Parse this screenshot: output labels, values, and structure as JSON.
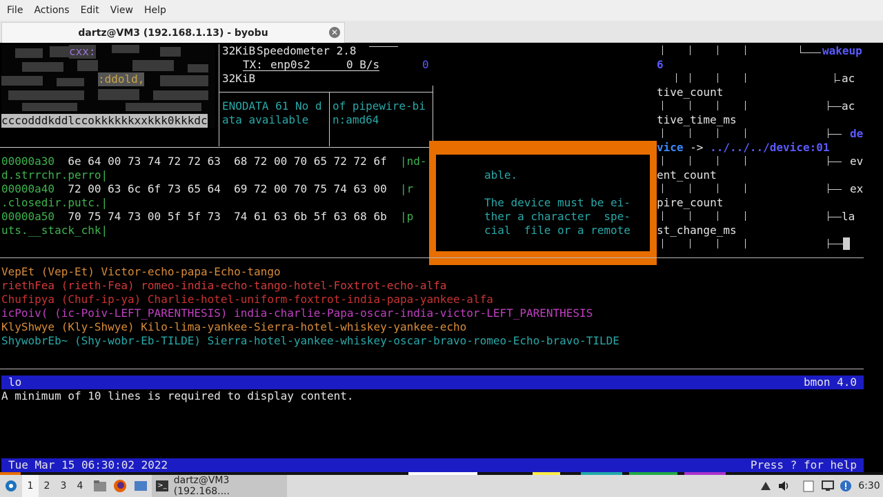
{
  "menubar": {
    "file": "File",
    "actions": "Actions",
    "edit": "Edit",
    "view": "View",
    "help": "Help"
  },
  "tab": {
    "title": "dartz@VM3 (192.168.1.13) - byobu"
  },
  "ascii_art": {
    "line1": "cxx:",
    "line2": ":ddold,",
    "line3": "cccodddkddlccokkkkkkxxkkk0kkkdc"
  },
  "speedometer": {
    "top_label": "32KiB",
    "title": "Speedometer 2.8",
    "tx_label": "TX:",
    "iface": "enp0s2",
    "rate": "0 B/s",
    "value": "0",
    "bottom_label": "32KiB"
  },
  "errno": {
    "line1": "ENODATA 61 No d",
    "line2": "ata available"
  },
  "pkg": {
    "line1": "of pipewire-bi",
    "line2": "n:amd64"
  },
  "hexdump": [
    {
      "addr": "00000a30",
      "bytes": "6e 64 00 73 74 72 72 63  68 72 00 70 65 72 72 6f",
      "ascii": "|nd-",
      "cont": "d.strrchr.perro|"
    },
    {
      "addr": "00000a40",
      "bytes": "72 00 63 6c 6f 73 65 64  69 72 00 70 75 74 63 00",
      "ascii": "|r",
      "cont": ".closedir.putc.|"
    },
    {
      "addr": "00000a50",
      "bytes": "70 75 74 73 00 5f 5f 73  74 61 63 6b 5f 63 68 6b",
      "ascii": "|p",
      "cont": "uts.__stack_chk|"
    }
  ],
  "manpage": {
    "line1": "able.",
    "line2": "The device must be ei-",
    "line3": "ther a character  spe-",
    "line4": "cial  file or a remote"
  },
  "tree": {
    "wakeup": "wakeup",
    "six": "6",
    "ac1": "ac",
    "tive_count": "tive_count",
    "ac2": "ac",
    "tive_time_ms": "tive_time_ms",
    "de": "de",
    "vice": "vice",
    "arrow": "->",
    "device_path": "../../../device:01",
    "ev": "ev",
    "ent_count": "ent_count",
    "ex": "ex",
    "pire_count": "pire_count",
    "la": "la",
    "st_change_ms": "st_change_ms"
  },
  "phonetic": [
    {
      "text": "VepEt (Vep-Et) Victor-echo-papa-Echo-tango",
      "color": "#d98c3a"
    },
    {
      "text": "riethFea (rieth-Fea) romeo-india-echo-tango-hotel-Foxtrot-echo-alfa",
      "color": "#d23a3a"
    },
    {
      "text": "Chufipya (Chuf-ip-ya) Charlie-hotel-uniform-foxtrot-india-papa-yankee-alfa",
      "color": "#c93232"
    },
    {
      "text": "icPoiv( (ic-Poiv-LEFT_PARENTHESIS) india-charlie-Papa-oscar-india-victor-LEFT_PARENTHESIS",
      "color": "#c040c0"
    },
    {
      "text": "KlyShwye (Kly-Shwye) Kilo-lima-yankee-Sierra-hotel-whiskey-yankee-echo",
      "color": "#d98c3a"
    },
    {
      "text": "ShywobrEb~ (Shy-wobr-Eb-TILDE) Sierra-hotel-yankee-whiskey-oscar-bravo-romeo-Echo-bravo-TILDE",
      "color": "#2aa8a8"
    }
  ],
  "bmon": {
    "iface": "lo",
    "version": "bmon 4.0",
    "message": "A minimum of 10 lines is required to display content."
  },
  "statusbar": {
    "datetime": "Tue Mar 15 06:30:02 2022",
    "help": "Press ? for help"
  },
  "taskbar": {
    "ws1": "1",
    "ws2": "2",
    "ws3": "3",
    "ws4": "4",
    "window_title": "dartz@VM3 (192.168....",
    "clock": "6:30"
  },
  "colors": {
    "accent_orange": "#e86e00",
    "bar_blue": "#1c1cc4"
  }
}
